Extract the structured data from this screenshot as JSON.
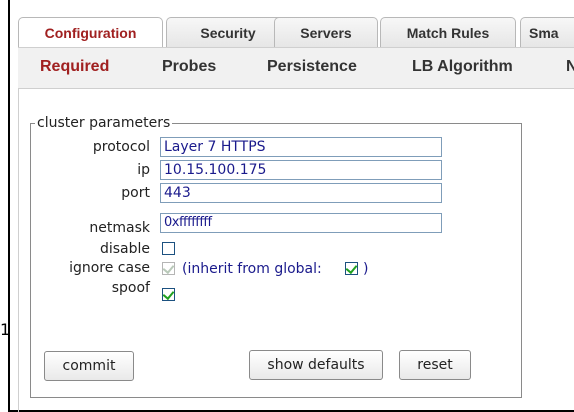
{
  "tabs": [
    {
      "label": "Configuration"
    },
    {
      "label": "Security"
    },
    {
      "label": "Servers"
    },
    {
      "label": "Match Rules"
    },
    {
      "label": "Sma"
    }
  ],
  "subtabs": [
    {
      "label": "Required"
    },
    {
      "label": "Probes"
    },
    {
      "label": "Persistence"
    },
    {
      "label": "LB Algorithm"
    },
    {
      "label": "N"
    }
  ],
  "cluster": {
    "legend": "cluster parameters",
    "protocol": {
      "label": "protocol",
      "value": "Layer 7 HTTPS"
    },
    "ip": {
      "label": "ip",
      "value": "10.15.100.175"
    },
    "port": {
      "label": "port",
      "value": "443"
    },
    "netmask": {
      "label": "netmask",
      "value": "0xffffffff"
    },
    "disable": {
      "label": "disable",
      "checked": false
    },
    "ignore_case": {
      "label": "ignore case",
      "checked": true,
      "disabled": true,
      "inherit_prefix": "(inherit from global:",
      "inherit_suffix": ")",
      "inherit_checked": true
    },
    "spoof": {
      "label": "spoof",
      "checked": true
    }
  },
  "buttons": {
    "commit": "commit",
    "show_defaults": "show defaults",
    "reset": "reset"
  },
  "edge_glyph": "1",
  "colors": {
    "active_tab": "#a02020",
    "input_text": "#1a1a8c",
    "check": "#21a121"
  }
}
